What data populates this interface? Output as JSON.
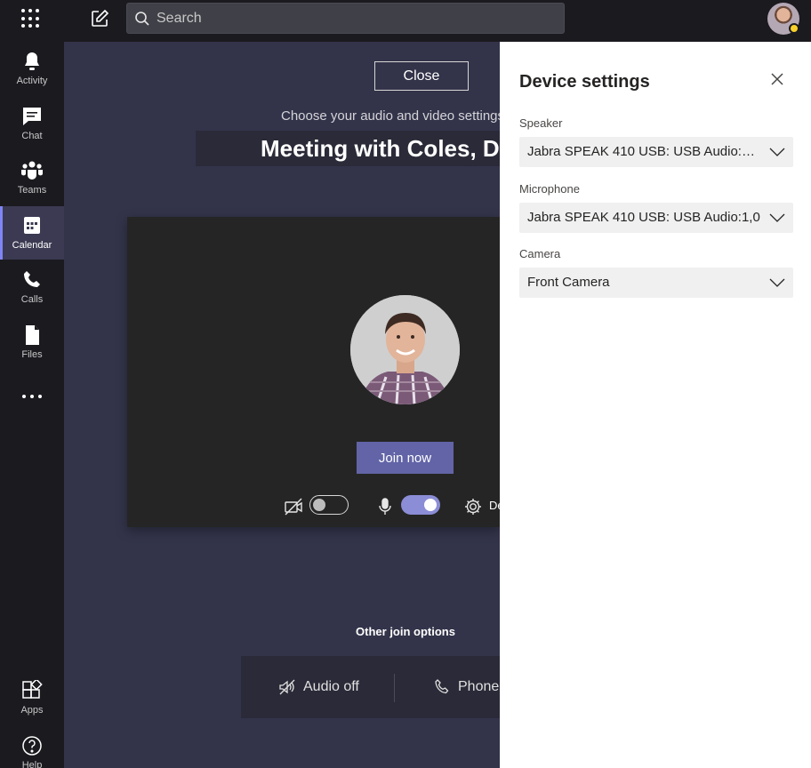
{
  "topbar": {
    "search_placeholder": "Search"
  },
  "rail": {
    "items": [
      {
        "label": "Activity"
      },
      {
        "label": "Chat"
      },
      {
        "label": "Teams"
      },
      {
        "label": "Calendar",
        "active": true
      },
      {
        "label": "Calls"
      },
      {
        "label": "Files"
      }
    ],
    "bottom": [
      {
        "label": "Apps"
      },
      {
        "label": "Help"
      }
    ]
  },
  "prejoin": {
    "close_label": "Close",
    "choose_text": "Choose your audio and video settings",
    "meeting_title": "Meeting with Coles, D",
    "join_label": "Join now",
    "camera_toggle": "off",
    "mic_toggle": "on",
    "devices_label": "De",
    "other_title": "Other join options",
    "audio_off_label": "Audio off",
    "phone_label": "Phone"
  },
  "device_settings": {
    "title": "Device settings",
    "speaker_label": "Speaker",
    "speaker_value": "Jabra SPEAK 410 USB: USB Audio:1,0:...",
    "microphone_label": "Microphone",
    "microphone_value": "Jabra SPEAK 410 USB: USB Audio:1,0",
    "camera_label": "Camera",
    "camera_value": "Front Camera"
  },
  "colors": {
    "accent": "#6264a7",
    "rail_bg": "#1b1a1f",
    "stage_bg": "#33344a",
    "presence": "#f8d22a"
  }
}
